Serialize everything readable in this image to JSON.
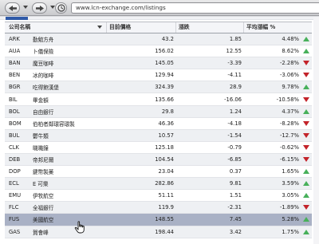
{
  "browser": {
    "url": "www.lcn-exchange.com/listings"
  },
  "colors": {
    "up": "#47b05a",
    "down": "#c3232a",
    "selected_row": "#a9b1c5",
    "accent": "#2f5aa8"
  },
  "table": {
    "headers": {
      "company": "公司名稱",
      "price": "目前價格",
      "change": "漲跌",
      "pct": "平均漲幅 %"
    },
    "rows": [
      {
        "sym": "ARK",
        "name": "勤勉方舟",
        "price": "43.2",
        "change": "1.85",
        "pct": "4.48%",
        "dir": "up"
      },
      {
        "sym": "AUA",
        "name": "卜儀保險",
        "price": "156.02",
        "change": "12.55",
        "pct": "8.62%",
        "dir": "up"
      },
      {
        "sym": "BAN",
        "name": "魔豆咖啡",
        "price": "145.05",
        "change": "-3.39",
        "pct": "-2.28%",
        "dir": "down"
      },
      {
        "sym": "BEN",
        "name": "冰的咖啡",
        "price": "129.94",
        "change": "-4.11",
        "pct": "-3.06%",
        "dir": "down"
      },
      {
        "sym": "BGR",
        "name": "吃得飽漢堡",
        "price": "324.39",
        "change": "28.9",
        "pct": "9.78%",
        "dir": "up"
      },
      {
        "sym": "BIL",
        "name": "畢金額",
        "price": "135.66",
        "change": "-16.06",
        "pct": "-10.58%",
        "dir": "down"
      },
      {
        "sym": "BOL",
        "name": "自由銀行",
        "price": "29.8",
        "change": "1.24",
        "pct": "4.37%",
        "dir": "up"
      },
      {
        "sym": "BOM",
        "name": "伯柏者鄰環容環製",
        "price": "46.36",
        "change": "-4.18",
        "pct": "-8.28%",
        "dir": "down"
      },
      {
        "sym": "BUL",
        "name": "鬱牛類",
        "price": "10.57",
        "change": "-1.54",
        "pct": "-12.7%",
        "dir": "down"
      },
      {
        "sym": "CLK",
        "name": "嘰嘰鐘",
        "price": "125.18",
        "change": "-0.79",
        "pct": "-0.62%",
        "dir": "down"
      },
      {
        "sym": "DEB",
        "name": "帝邦尼爾",
        "price": "104.54",
        "change": "-6.85",
        "pct": "-6.15%",
        "dir": "down"
      },
      {
        "sym": "DOP",
        "name": "鍵幣製藥",
        "price": "23.04",
        "change": "0.37",
        "pct": "1.65%",
        "dir": "up"
      },
      {
        "sym": "ECL",
        "name": "E 可樂",
        "price": "282.86",
        "change": "9.81",
        "pct": "3.59%",
        "dir": "up"
      },
      {
        "sym": "EMU",
        "name": "伊牧航空",
        "price": "51.11",
        "change": "1.51",
        "pct": "3.05%",
        "dir": "up"
      },
      {
        "sym": "FLC",
        "name": "全福銀行",
        "price": "119.9",
        "change": "-2.31",
        "pct": "-1.89%",
        "dir": "down"
      },
      {
        "sym": "FUS",
        "name": "美國航空",
        "price": "148.55",
        "change": "7.45",
        "pct": "5.28%",
        "dir": "up",
        "selected": true
      },
      {
        "sym": "GAS",
        "name": "賀會峰",
        "price": "198.44",
        "change": "3.42",
        "pct": "1.75%",
        "dir": "up"
      }
    ]
  }
}
